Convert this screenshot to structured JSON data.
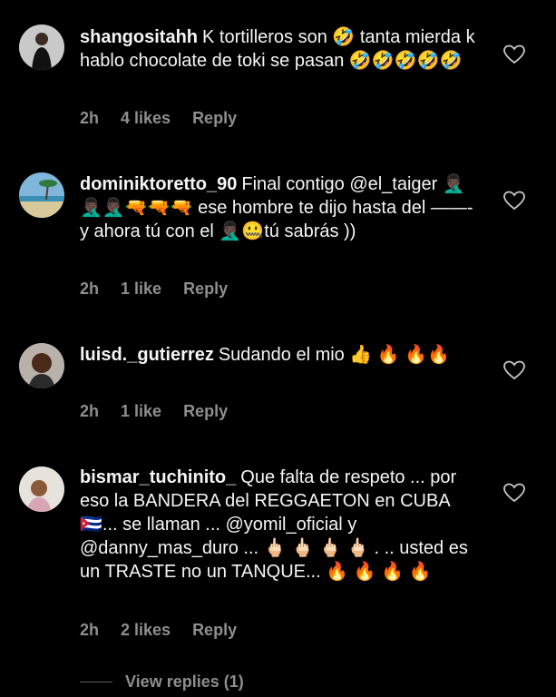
{
  "comments": [
    {
      "username": "shangositahh",
      "text": "K tortilleros son 🤣 tanta mierda k hablo chocolate de toki se pasan 🤣🤣🤣🤣🤣",
      "time": "2h",
      "likes": "4 likes",
      "reply": "Reply",
      "avatar_icon": "user-photo-avatar-icon"
    },
    {
      "username": "dominiktoretto_90",
      "text": "Final contigo @el_taiger 🤦🏿‍♂️🤦🏿‍♂️🤦🏿‍♂️🔫🔫🔫 ese hombre te dijo hasta del ——- y ahora tú con el 🤦🏿‍♂️🤐tú sabrás ))",
      "time": "2h",
      "likes": "1 like",
      "reply": "Reply",
      "avatar_icon": "beach-photo-avatar-icon"
    },
    {
      "username": "luisd._gutierrez",
      "text": "Sudando el mio 👍 🔥 🔥🔥",
      "time": "2h",
      "likes": "1 like",
      "reply": "Reply",
      "avatar_icon": "user-photo-avatar-icon"
    },
    {
      "username": "bismar_tuchinito_",
      "text": "Que falta de respeto ... por eso la BANDERA del REGGAETON en CUBA 🇨🇺... se llaman ... @yomil_oficial y @danny_mas_duro ... 🖕🏻 🖕🏻 🖕🏻 🖕🏻 . .. usted es un TRASTE no un TANQUE... 🔥 🔥 🔥 🔥",
      "time": "2h",
      "likes": "2 likes",
      "reply": "Reply",
      "avatar_icon": "user-photo-avatar-icon"
    }
  ],
  "view_replies": "View replies (1)",
  "colors": {
    "background": "#000000",
    "text": "#f5f5f5",
    "secondary": "#8e8e8e"
  }
}
